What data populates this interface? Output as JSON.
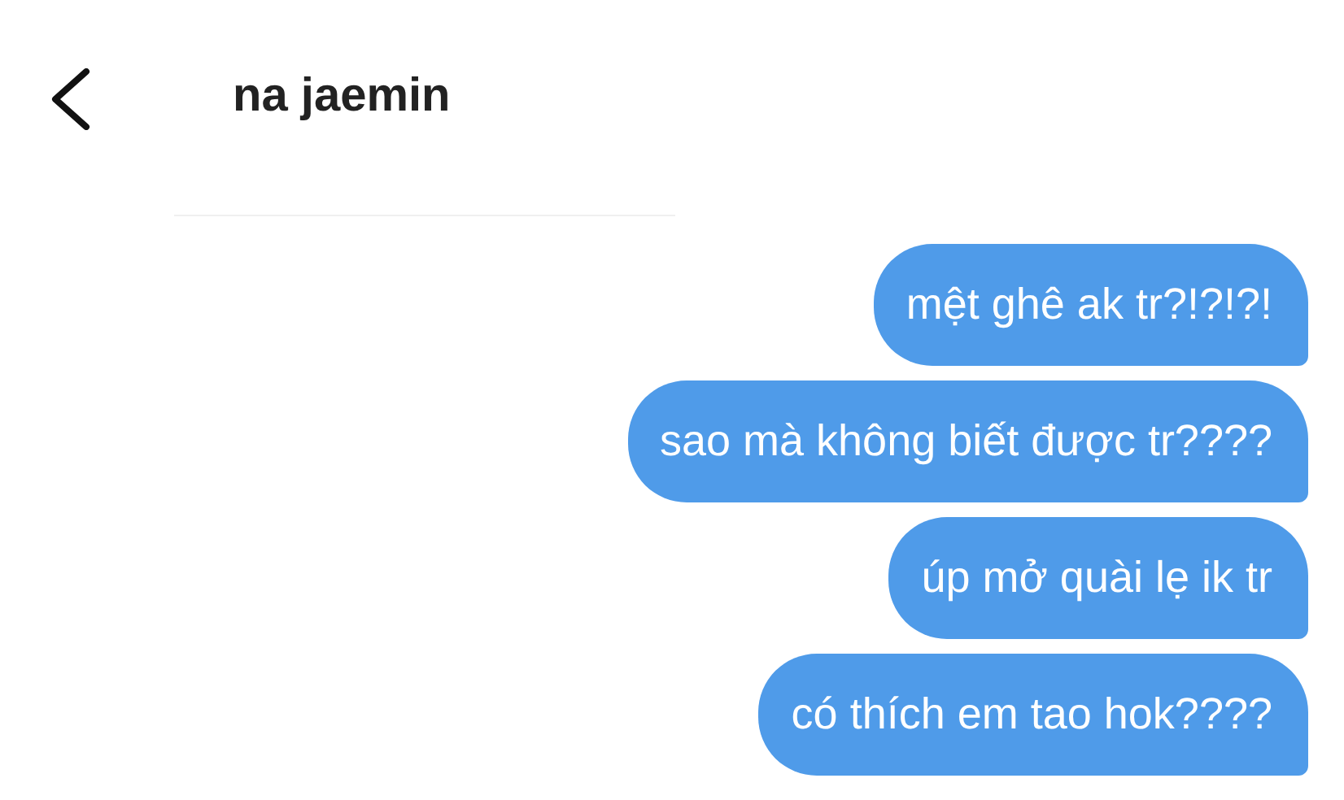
{
  "header": {
    "title": "na jaemin"
  },
  "messages": [
    "mệt ghê ak tr?!?!?!",
    "sao mà không biết được tr????",
    "úp mở quài lẹ ik tr",
    "có thích em tao hok????"
  ]
}
